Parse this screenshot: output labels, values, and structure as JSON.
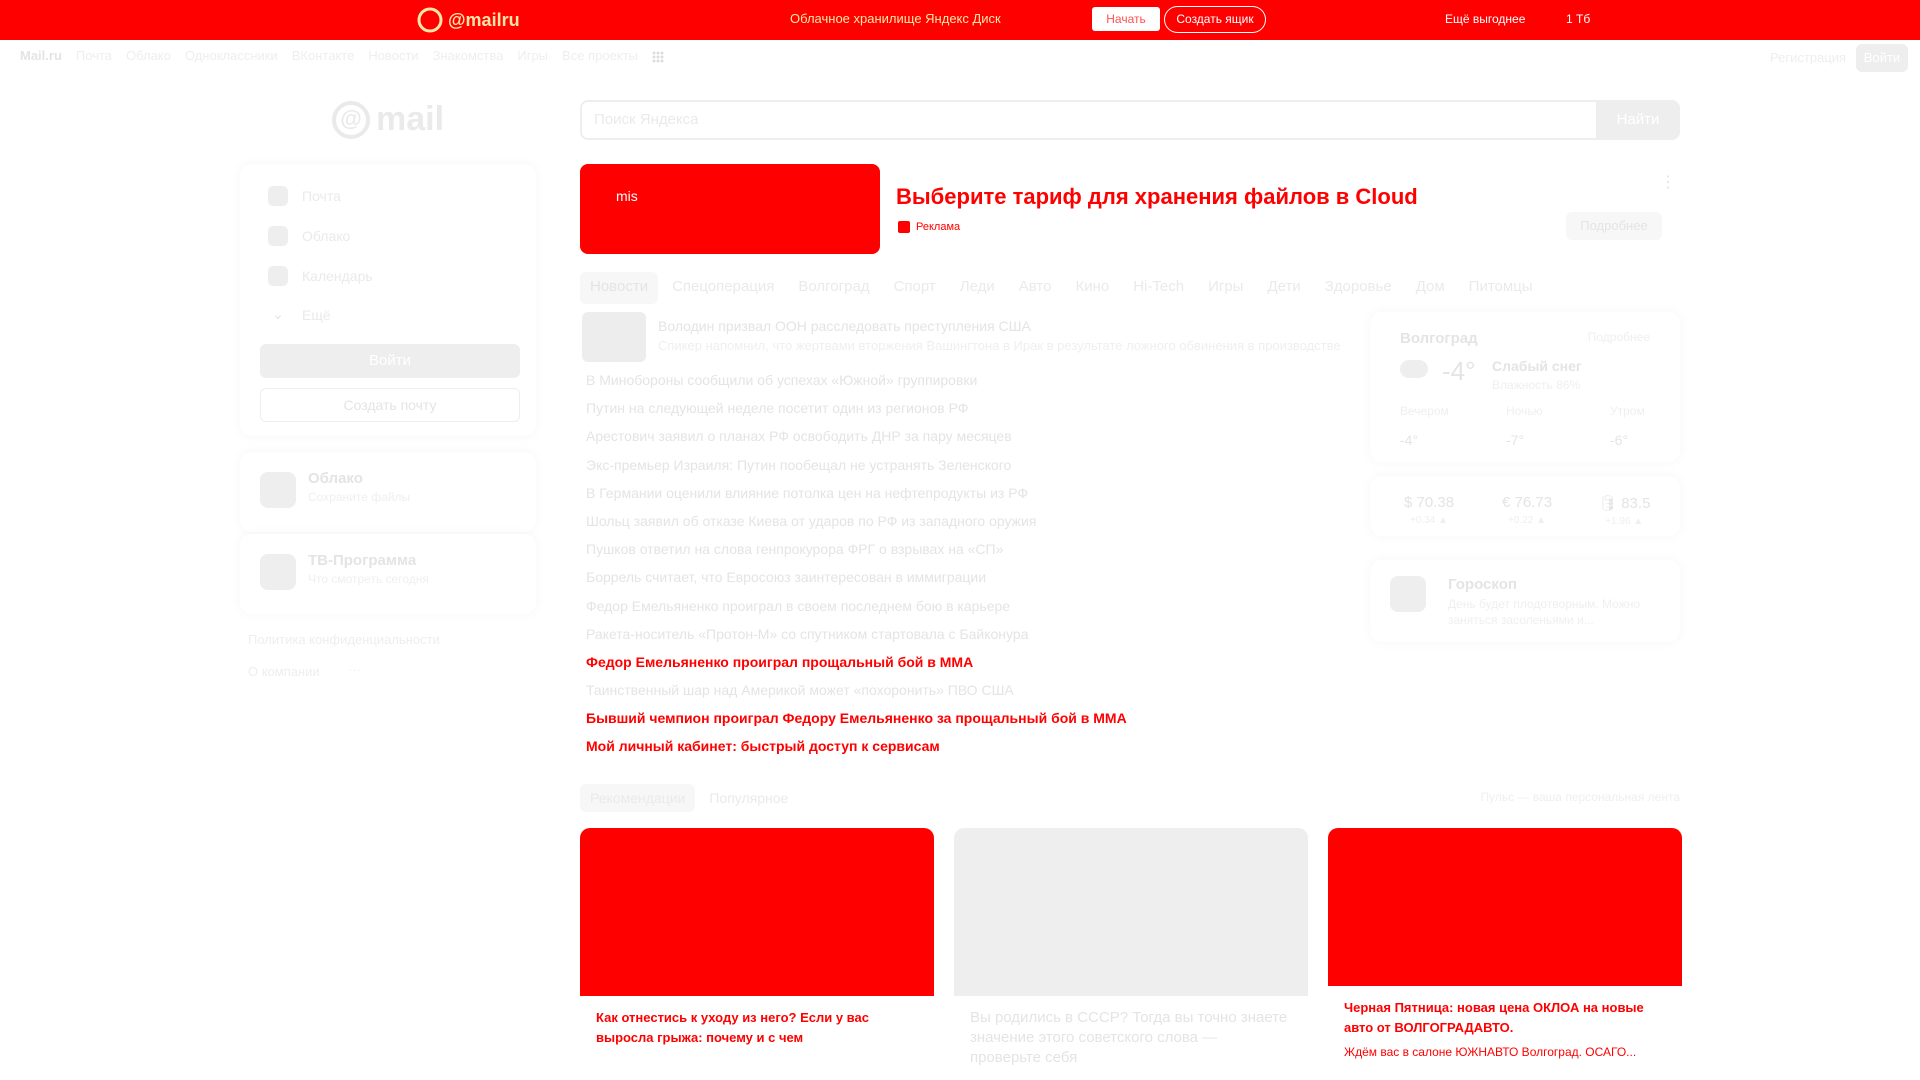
{
  "top_banner": {
    "logo_text": "@mailru",
    "text": "Облачное хранилище Яндекс Диск",
    "white_button": "Начать",
    "outline_button": "Создать ящик",
    "right_1": "Ещё выгоднее",
    "right_2": "1 Тб"
  },
  "nav": {
    "items": [
      "Mail.ru",
      "Почта",
      "Облако",
      "Одноклассники",
      "ВКонтакте",
      "Новости",
      "Знакомства",
      "Игры",
      "Все проекты"
    ],
    "register": "Регистрация",
    "login": "Войти"
  },
  "logo": {
    "symbol": "@",
    "text": "mail"
  },
  "search": {
    "placeholder": "Поиск Яндекса",
    "button": "Найти"
  },
  "sidebar": {
    "items": [
      {
        "label": "Почта"
      },
      {
        "label": "Облако"
      },
      {
        "label": "Календарь"
      },
      {
        "label": "Ещё"
      }
    ],
    "login_button": "Войти",
    "create_button": "Создать почту",
    "cloud_title": "Облако",
    "cloud_sub": "Сохраните файлы",
    "tv_title": "ТВ-Программа",
    "tv_sub": "Что смотреть сегодня",
    "privacy": "Политика конфиденциальности",
    "about": "О компании",
    "about_more": "···"
  },
  "promo": {
    "image_text": "mis",
    "title": "Выберите тариф для хранения файлов в Cloud",
    "meta": "Реклама",
    "more": "Подробнее",
    "dots": "⋮"
  },
  "tabs": [
    "Новости",
    "Спецоперация",
    "Волгоград",
    "Спорт",
    "Леди",
    "Авто",
    "Кино",
    "Hi-Tech",
    "Игры",
    "Дети",
    "Здоровье",
    "Дом",
    "Питомцы"
  ],
  "news": {
    "lead_title": "Володин призвал ООН расследовать преступления США",
    "lead_sub": "Спикер напомнил, что жертвами вторжения Вашингтона в Ирак в результате ложного обвинения в производстве",
    "items": [
      {
        "text": "В Минобороны сообщили об успехах «Южной» группировки"
      },
      {
        "text": "Путин на следующей неделе посетит один из регионов РФ"
      },
      {
        "text": "Арестович заявил о планах РФ освободить ДНР за пару месяцев"
      },
      {
        "text": "Экс-премьер Израиля: Путин пообещал не устранять Зеленского"
      },
      {
        "text": "В Германии оценили влияние потолка цен на нефтепродукты из РФ"
      },
      {
        "text": "Шольц заявил об отказе Киева от ударов по РФ из западного оружия"
      },
      {
        "text": "Пушков ответил на слова генпрокурора ФРГ о взрывах на «СП»"
      },
      {
        "text": "Боррель считает, что Евросоюз заинтересован в иммиграции"
      },
      {
        "text": "Федор Емельяненко проиграл в своем последнем бою в карьере"
      },
      {
        "text": "Ракета-носитель «Протон-М» со спутником стартовала с Байконура"
      },
      {
        "text": "Федор Емельяненко проиграл прощальный бой в ММА",
        "promo": true
      },
      {
        "text": "Таинственный шар над Америкой может «похоронить» ПВО США"
      },
      {
        "text": "Бывший чемпион проиграл Федору Емельяненко за прощальный бой в ММА",
        "promo": true
      },
      {
        "text": "Мой личный кабинет: быстрый доступ к сервисам",
        "promo": true
      }
    ]
  },
  "weather": {
    "city": "Волгоград",
    "more": "Подробнее",
    "temp": "-4°",
    "desc": "Слабый снег",
    "humidity": "Влажность 86%",
    "parts": [
      {
        "name": "Вечером",
        "temp": "-4°"
      },
      {
        "name": "Ночью",
        "temp": "-7°"
      },
      {
        "name": "Утром",
        "temp": "-6°"
      }
    ]
  },
  "currency": [
    {
      "symbol": "$",
      "value": "70.38",
      "delta": "+0.34 ▲"
    },
    {
      "symbol": "€",
      "value": "76.73",
      "delta": "+0.22 ▲"
    },
    {
      "symbol": "🛢",
      "value": "83.5",
      "delta": "+1.96 ▲"
    }
  ],
  "horoscope": {
    "title": "Гороскоп",
    "text": "День будет плодотворным. Можно заняться засоленьями и..."
  },
  "feed": {
    "tabs": [
      "Рекомендации",
      "Популярное"
    ],
    "note": "Пульс — ваша персональная лента",
    "cards": [
      {
        "title": "Как отнестись к уходу из него? Если у вас выросла грыжа: почему и с чем"
      },
      {
        "title": "Вы родились в СССР? Тогда вы точно знаете значение этого советского слова — проверьте себя"
      },
      {
        "title": "Черная Пятница: новая цена ОКЛОА на новые авто от ВОЛГОГРАДАВТО.",
        "sub": "Ждём вас в салоне ЮЖНАВТО Волгоград. ОСАГО..."
      }
    ]
  }
}
